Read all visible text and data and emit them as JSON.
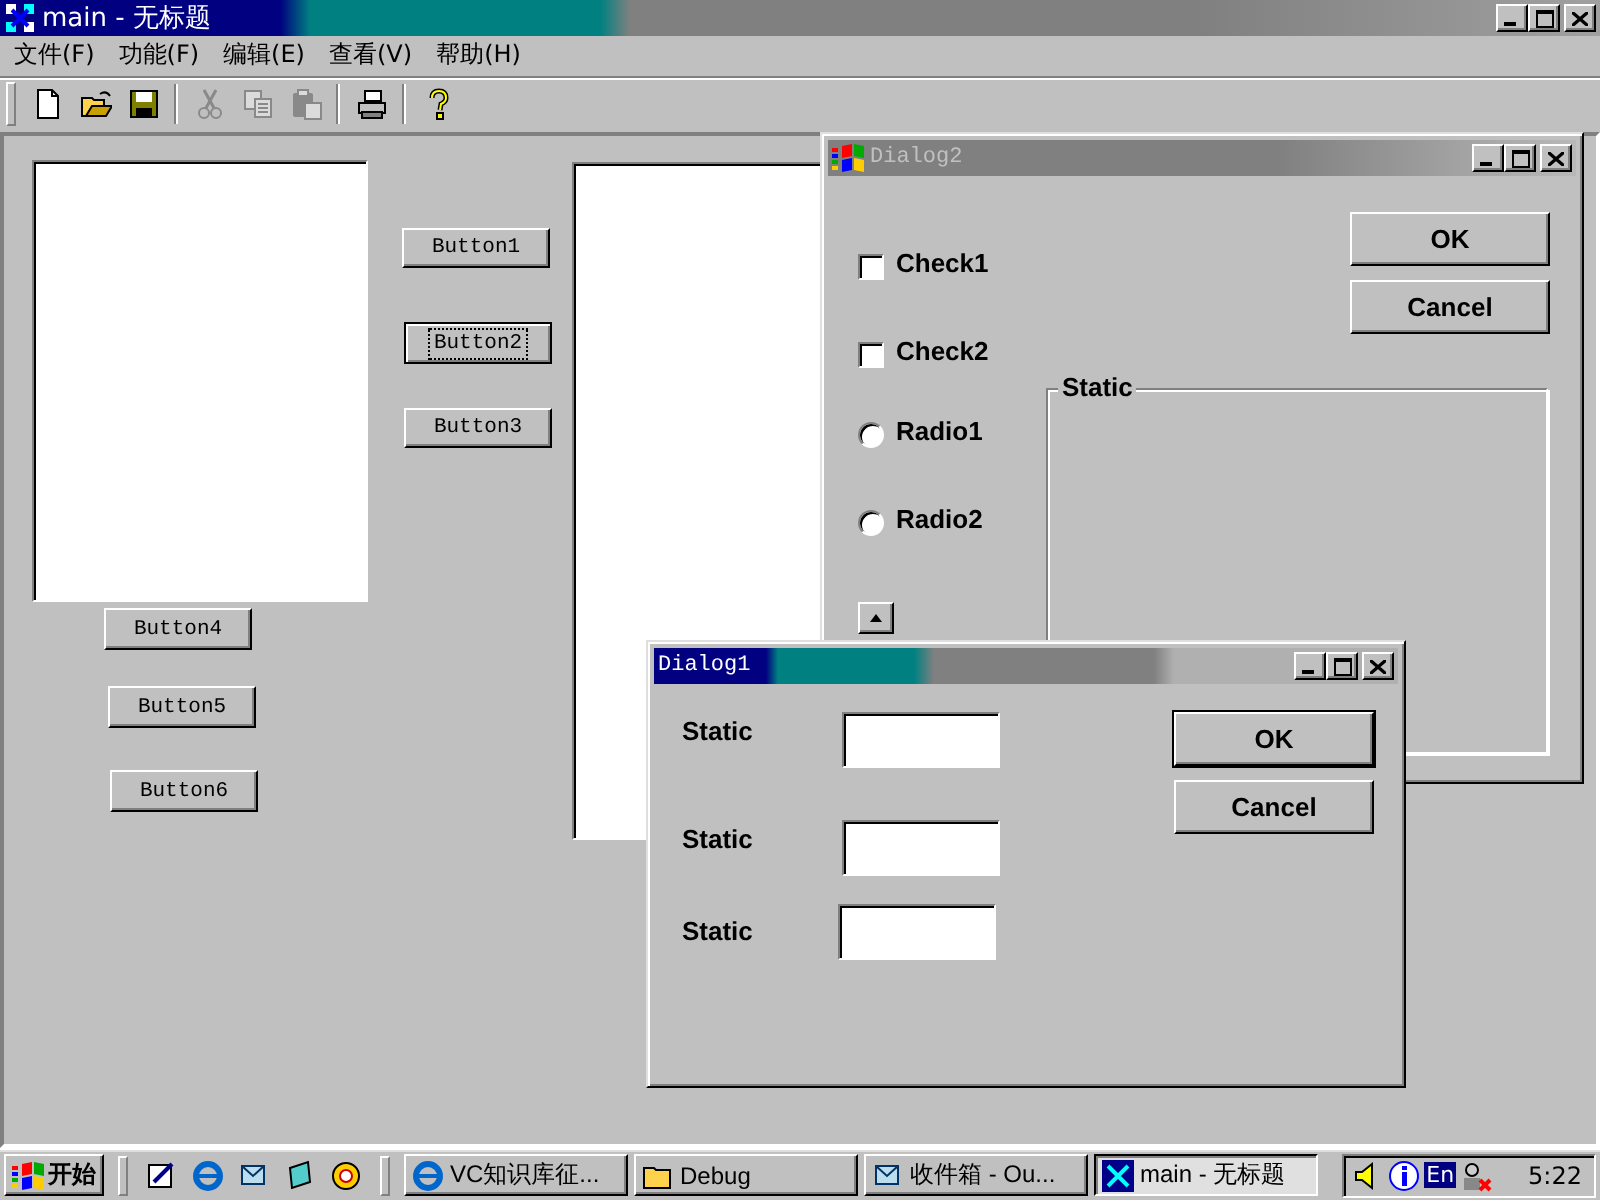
{
  "main_window": {
    "title": "main - 无标题",
    "active": true,
    "menu": [
      "文件(F)",
      "功能(F)",
      "编辑(E)",
      "查看(V)",
      "帮助(H)"
    ],
    "toolbar": [
      [
        {
          "kind": "new",
          "disabled": false
        },
        {
          "kind": "open",
          "disabled": false
        },
        {
          "kind": "save",
          "disabled": false
        }
      ],
      [
        {
          "kind": "cut",
          "disabled": true
        },
        {
          "kind": "copy",
          "disabled": true
        },
        {
          "kind": "paste",
          "disabled": true
        }
      ],
      [
        {
          "kind": "print",
          "disabled": false
        }
      ],
      [
        {
          "kind": "help",
          "disabled": false
        }
      ]
    ],
    "buttons": [
      {
        "label": "Button1",
        "focused": false
      },
      {
        "label": "Button2",
        "focused": true
      },
      {
        "label": "Button3",
        "focused": false
      },
      {
        "label": "Button4",
        "focused": false
      },
      {
        "label": "Button5",
        "focused": false
      },
      {
        "label": "Button6",
        "focused": false
      }
    ]
  },
  "dialog2": {
    "title": "Dialog2",
    "active": false,
    "checkboxes": [
      {
        "label": "Check1",
        "checked": false
      },
      {
        "label": "Check2",
        "checked": false
      }
    ],
    "radios": [
      {
        "label": "Radio1",
        "selected": false
      },
      {
        "label": "Radio2",
        "selected": false
      }
    ],
    "buttons": [
      {
        "label": "OK",
        "default": false
      },
      {
        "label": "Cancel",
        "default": false
      }
    ],
    "group_box": {
      "label": "Static"
    }
  },
  "dialog1": {
    "title": "Dialog1",
    "active": true,
    "fields": [
      {
        "label": "Static"
      },
      {
        "label": "Static"
      },
      {
        "label": "Static"
      }
    ],
    "buttons": [
      {
        "label": "OK",
        "default": true
      },
      {
        "label": "Cancel",
        "default": false
      }
    ]
  },
  "taskbar": {
    "start": "开始",
    "tasks": [
      {
        "label": "VC知识库征...",
        "selected": false
      },
      {
        "label": "Debug",
        "selected": false
      },
      {
        "label": "收件箱 - Ou...",
        "selected": false
      },
      {
        "label": "main - 无标题",
        "selected": true
      }
    ],
    "language": "En",
    "clock": "5:22"
  }
}
